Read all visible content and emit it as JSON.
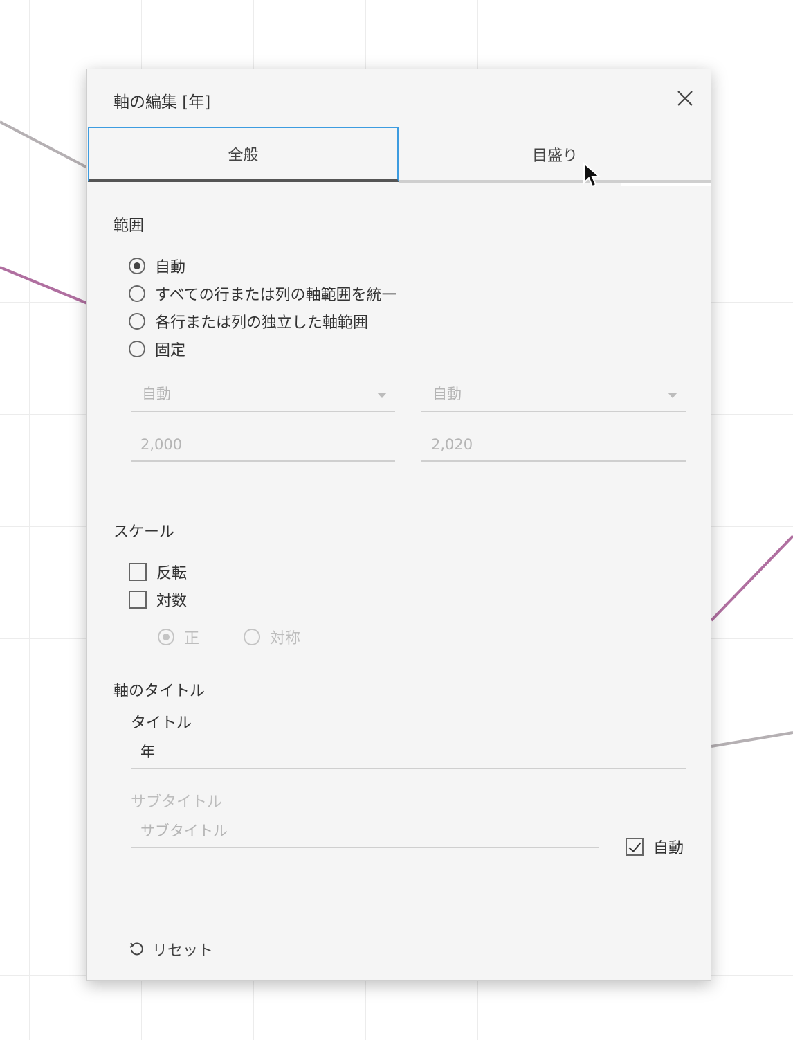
{
  "dialog": {
    "title": "軸の編集 [年]",
    "tabs": [
      {
        "label": "全般",
        "selected": true
      },
      {
        "label": "目盛り",
        "selected": false
      }
    ]
  },
  "range": {
    "section_title": "範囲",
    "options": [
      {
        "label": "自動",
        "checked": true
      },
      {
        "label": "すべての行または列の軸範囲を統一",
        "checked": false
      },
      {
        "label": "各行または列の独立した軸範囲",
        "checked": false
      },
      {
        "label": "固定",
        "checked": false
      }
    ],
    "min_mode": "自動",
    "max_mode": "自動",
    "min_value": "2,000",
    "max_value": "2,020"
  },
  "scale": {
    "section_title": "スケール",
    "reverse_label": "反転",
    "log_label": "対数",
    "positive_label": "正",
    "symmetric_label": "対称"
  },
  "axis_title": {
    "section_title": "軸のタイトル",
    "title_label": "タイトル",
    "title_value": "年",
    "subtitle_label": "サブタイトル",
    "subtitle_placeholder": "サブタイトル",
    "auto_label": "自動",
    "auto_checked": true
  },
  "footer": {
    "reset_label": "リセット"
  },
  "colors": {
    "tab_focus": "#3d9ce0",
    "line_purple": "#b06fa0",
    "line_gray": "#b5b0b3"
  },
  "icons": [
    "close-icon",
    "reset-icon",
    "cursor-icon",
    "caret-down-icon",
    "checkmark-icon"
  ]
}
